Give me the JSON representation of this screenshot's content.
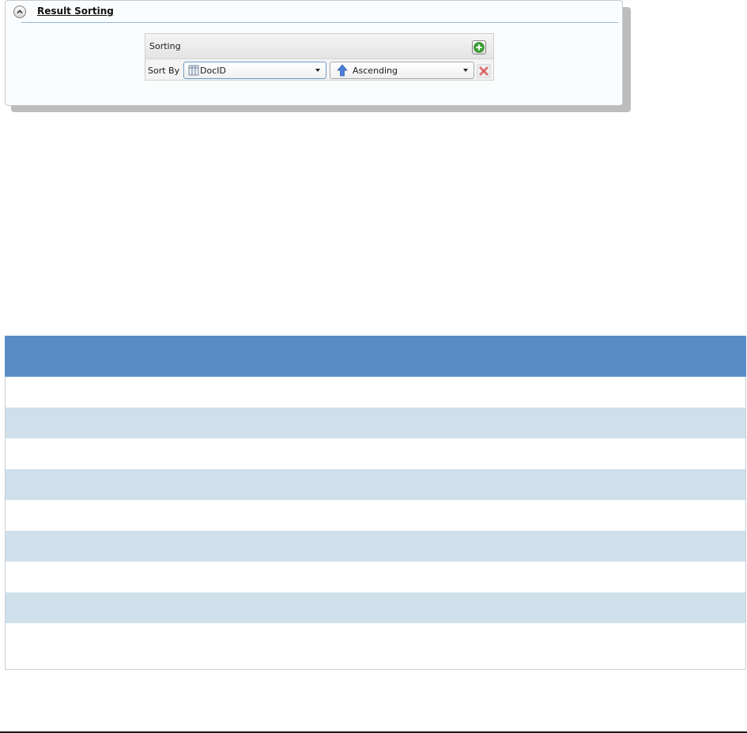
{
  "panel": {
    "title": "Result Sorting",
    "collapse_icon": "chevron-up-icon"
  },
  "sorting": {
    "header_label": "Sorting",
    "add_icon": "plus-circle-icon",
    "sort_by_label": "Sort By",
    "field_value": "DocID",
    "field_icon": "field-column-icon",
    "order_value": "Ascending",
    "order_icon": "arrow-up-icon",
    "remove_icon": "delete-x-icon"
  },
  "colors": {
    "table_header": "#5b8bc4",
    "table_row_alt": "#d0e0ea",
    "add_green": "#3fa535",
    "remove_red": "#d64a4a",
    "arrow_blue": "#4a7fd8"
  },
  "results_table": {
    "rows": [
      {
        "cells": []
      },
      {
        "cells": []
      },
      {
        "cells": []
      },
      {
        "cells": []
      },
      {
        "cells": []
      },
      {
        "cells": []
      },
      {
        "cells": []
      },
      {
        "cells": []
      },
      {
        "cells": []
      }
    ]
  }
}
